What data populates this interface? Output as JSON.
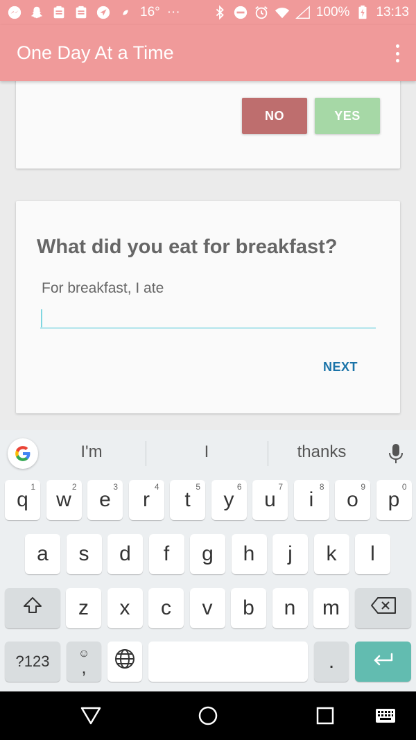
{
  "status_bar": {
    "temperature": "16°",
    "more": "···",
    "battery": "100%",
    "time": "13:13"
  },
  "app_bar": {
    "title": "One Day At a Time"
  },
  "prev_card": {
    "no_label": "NO",
    "yes_label": "YES"
  },
  "question_card": {
    "question": "What did you eat for breakfast?",
    "field_label": "For breakfast, I ate",
    "field_value": "",
    "next_label": "NEXT"
  },
  "keyboard": {
    "suggestions": [
      "I'm",
      "I",
      "thanks"
    ],
    "row1": [
      {
        "k": "q",
        "h": "1"
      },
      {
        "k": "w",
        "h": "2"
      },
      {
        "k": "e",
        "h": "3"
      },
      {
        "k": "r",
        "h": "4"
      },
      {
        "k": "t",
        "h": "5"
      },
      {
        "k": "y",
        "h": "6"
      },
      {
        "k": "u",
        "h": "7"
      },
      {
        "k": "i",
        "h": "8"
      },
      {
        "k": "o",
        "h": "9"
      },
      {
        "k": "p",
        "h": "0"
      }
    ],
    "row2": [
      "a",
      "s",
      "d",
      "f",
      "g",
      "h",
      "j",
      "k",
      "l"
    ],
    "row3": [
      "z",
      "x",
      "c",
      "v",
      "b",
      "n",
      "m"
    ],
    "symbols_label": "?123",
    "comma_label": ",",
    "period_label": "."
  },
  "colors": {
    "primary": "#f09a9a",
    "no_button": "#be6e6e",
    "yes_button": "#a6d8a6",
    "next_text": "#1a73a8",
    "enter_key": "#62bcb0"
  }
}
